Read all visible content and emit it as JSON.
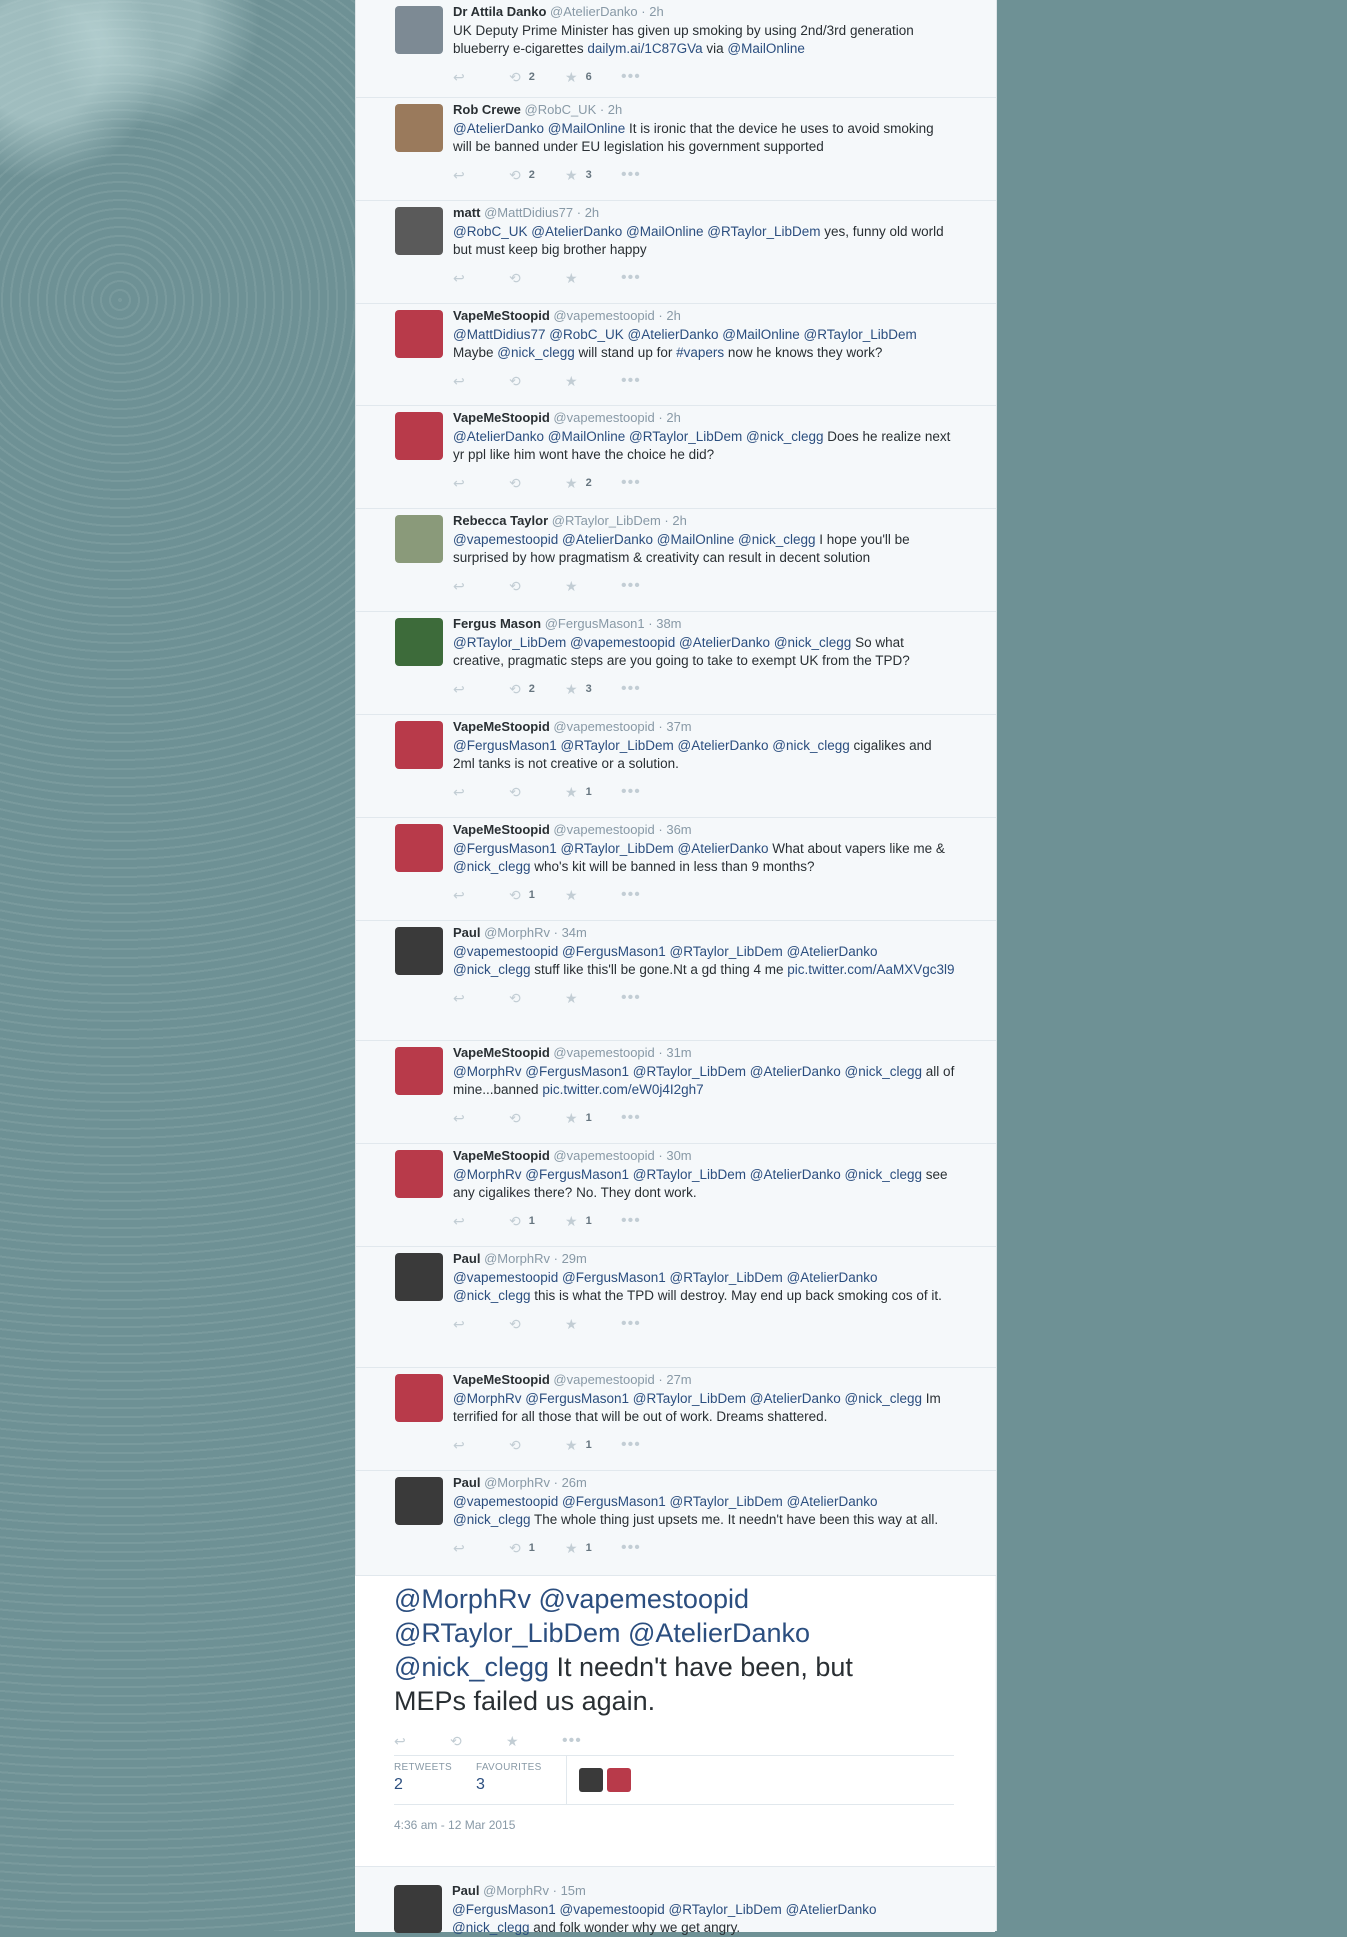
{
  "tweets": [
    {
      "name": "Dr Attila Danko",
      "handle": "@AtelierDanko",
      "time": "· 2h",
      "avatar": "#7d8a94",
      "parts": [
        [
          "UK Deputy Prime Minister has given up smoking by using 2nd/3rd generation blueberry e-cigarettes ",
          false
        ],
        [
          "dailym.ai/1C87GVa",
          true
        ],
        [
          " via ",
          false
        ],
        [
          "@MailOnline",
          true
        ]
      ],
      "retweets": "2",
      "favorites": "6"
    },
    {
      "name": "Rob Crewe",
      "handle": "@RobC_UK",
      "time": "· 2h",
      "avatar": "#9a7a5c",
      "parts": [
        [
          "@AtelierDanko",
          true
        ],
        [
          " ",
          false
        ],
        [
          "@MailOnline",
          true
        ],
        [
          " It is ironic that the device he uses to avoid smoking will be banned under EU legislation his government supported",
          false
        ]
      ],
      "retweets": "2",
      "favorites": "3"
    },
    {
      "name": "matt",
      "handle": "@MattDidius77",
      "time": "· 2h",
      "avatar": "#5a5a5a",
      "parts": [
        [
          "@RobC_UK",
          true
        ],
        [
          " ",
          false
        ],
        [
          "@AtelierDanko",
          true
        ],
        [
          " ",
          false
        ],
        [
          "@MailOnline",
          true
        ],
        [
          " ",
          false
        ],
        [
          "@RTaylor_LibDem",
          true
        ],
        [
          " yes, funny old world but must keep big brother happy",
          false
        ]
      ],
      "retweets": "",
      "favorites": ""
    },
    {
      "name": "VapeMeStoopid",
      "handle": "@vapemestoopid",
      "time": "· 2h",
      "avatar": "#b83a4a",
      "parts": [
        [
          "@MattDidius77",
          true
        ],
        [
          " ",
          false
        ],
        [
          "@RobC_UK",
          true
        ],
        [
          " ",
          false
        ],
        [
          "@AtelierDanko",
          true
        ],
        [
          " ",
          false
        ],
        [
          "@MailOnline",
          true
        ],
        [
          " ",
          false
        ],
        [
          "@RTaylor_LibDem",
          true
        ],
        [
          " Maybe ",
          false
        ],
        [
          "@nick_clegg",
          true
        ],
        [
          " will stand up for ",
          false
        ],
        [
          "#vapers",
          true
        ],
        [
          " now he knows they work?",
          false
        ]
      ],
      "retweets": "",
      "favorites": ""
    },
    {
      "name": "VapeMeStoopid",
      "handle": "@vapemestoopid",
      "time": "· 2h",
      "avatar": "#b83a4a",
      "parts": [
        [
          "@AtelierDanko",
          true
        ],
        [
          " ",
          false
        ],
        [
          "@MailOnline",
          true
        ],
        [
          " ",
          false
        ],
        [
          "@RTaylor_LibDem",
          true
        ],
        [
          " ",
          false
        ],
        [
          "@nick_clegg",
          true
        ],
        [
          " Does he realize next yr ppl like him wont have the choice he did?",
          false
        ]
      ],
      "retweets": "",
      "favorites": "2"
    },
    {
      "name": "Rebecca Taylor",
      "handle": "@RTaylor_LibDem",
      "time": "· 2h",
      "avatar": "#8a9a7a",
      "parts": [
        [
          "@vapemestoopid",
          true
        ],
        [
          " ",
          false
        ],
        [
          "@AtelierDanko",
          true
        ],
        [
          " ",
          false
        ],
        [
          "@MailOnline",
          true
        ],
        [
          " ",
          false
        ],
        [
          "@nick_clegg",
          true
        ],
        [
          " I hope you'll be surprised by how pragmatism & creativity can result in decent solution",
          false
        ]
      ],
      "retweets": "",
      "favorites": ""
    },
    {
      "name": "Fergus Mason",
      "handle": "@FergusMason1",
      "time": "· 38m",
      "avatar": "#3d6b3a",
      "parts": [
        [
          "@RTaylor_LibDem",
          true
        ],
        [
          " ",
          false
        ],
        [
          "@vapemestoopid",
          true
        ],
        [
          " ",
          false
        ],
        [
          "@AtelierDanko",
          true
        ],
        [
          " ",
          false
        ],
        [
          "@nick_clegg",
          true
        ],
        [
          " So what creative, pragmatic steps are you going to take to exempt UK from the TPD?",
          false
        ]
      ],
      "retweets": "2",
      "favorites": "3"
    },
    {
      "name": "VapeMeStoopid",
      "handle": "@vapemestoopid",
      "time": "· 37m",
      "avatar": "#b83a4a",
      "parts": [
        [
          "@FergusMason1",
          true
        ],
        [
          " ",
          false
        ],
        [
          "@RTaylor_LibDem",
          true
        ],
        [
          " ",
          false
        ],
        [
          "@AtelierDanko",
          true
        ],
        [
          " ",
          false
        ],
        [
          "@nick_clegg",
          true
        ],
        [
          " cigalikes and 2ml tanks is not creative or a solution.",
          false
        ]
      ],
      "retweets": "",
      "favorites": "1"
    },
    {
      "name": "VapeMeStoopid",
      "handle": "@vapemestoopid",
      "time": "· 36m",
      "avatar": "#b83a4a",
      "parts": [
        [
          "@FergusMason1",
          true
        ],
        [
          " ",
          false
        ],
        [
          "@RTaylor_LibDem",
          true
        ],
        [
          " ",
          false
        ],
        [
          "@AtelierDanko",
          true
        ],
        [
          " What about vapers like me & ",
          false
        ],
        [
          "@nick_clegg",
          true
        ],
        [
          " who's kit will be banned in less than 9 months?",
          false
        ]
      ],
      "retweets": "1",
      "favorites": ""
    },
    {
      "name": "Paul",
      "handle": "@MorphRv",
      "time": "· 34m",
      "avatar": "#3a3a3a",
      "parts": [
        [
          "@vapemestoopid",
          true
        ],
        [
          " ",
          false
        ],
        [
          "@FergusMason1",
          true
        ],
        [
          " ",
          false
        ],
        [
          "@RTaylor_LibDem",
          true
        ],
        [
          " ",
          false
        ],
        [
          "@AtelierDanko",
          true
        ],
        [
          " ",
          false
        ],
        [
          "@nick_clegg",
          true
        ],
        [
          " stuff like this'll be gone.Nt a gd thing 4 me ",
          false
        ],
        [
          "pic.twitter.com/AaMXVgc3l9",
          true
        ]
      ],
      "retweets": "",
      "favorites": ""
    },
    {
      "name": "VapeMeStoopid",
      "handle": "@vapemestoopid",
      "time": "· 31m",
      "avatar": "#b83a4a",
      "parts": [
        [
          "@MorphRv",
          true
        ],
        [
          " ",
          false
        ],
        [
          "@FergusMason1",
          true
        ],
        [
          " ",
          false
        ],
        [
          "@RTaylor_LibDem",
          true
        ],
        [
          " ",
          false
        ],
        [
          "@AtelierDanko",
          true
        ],
        [
          " ",
          false
        ],
        [
          "@nick_clegg",
          true
        ],
        [
          " all of mine...banned ",
          false
        ],
        [
          "pic.twitter.com/eW0j4I2gh7",
          true
        ]
      ],
      "retweets": "",
      "favorites": "1"
    },
    {
      "name": "VapeMeStoopid",
      "handle": "@vapemestoopid",
      "time": "· 30m",
      "avatar": "#b83a4a",
      "parts": [
        [
          "@MorphRv",
          true
        ],
        [
          " ",
          false
        ],
        [
          "@FergusMason1",
          true
        ],
        [
          " ",
          false
        ],
        [
          "@RTaylor_LibDem",
          true
        ],
        [
          " ",
          false
        ],
        [
          "@AtelierDanko",
          true
        ],
        [
          " ",
          false
        ],
        [
          "@nick_clegg",
          true
        ],
        [
          " see any cigalikes there? No. They dont work.",
          false
        ]
      ],
      "retweets": "1",
      "favorites": "1"
    },
    {
      "name": "Paul",
      "handle": "@MorphRv",
      "time": "· 29m",
      "avatar": "#3a3a3a",
      "parts": [
        [
          "@vapemestoopid",
          true
        ],
        [
          " ",
          false
        ],
        [
          "@FergusMason1",
          true
        ],
        [
          " ",
          false
        ],
        [
          "@RTaylor_LibDem",
          true
        ],
        [
          " ",
          false
        ],
        [
          "@AtelierDanko",
          true
        ],
        [
          " ",
          false
        ],
        [
          "@nick_clegg",
          true
        ],
        [
          " this is what the TPD will destroy. May end up back smoking cos of it.",
          false
        ]
      ],
      "retweets": "",
      "favorites": ""
    },
    {
      "name": "VapeMeStoopid",
      "handle": "@vapemestoopid",
      "time": "· 27m",
      "avatar": "#b83a4a",
      "parts": [
        [
          "@MorphRv",
          true
        ],
        [
          " ",
          false
        ],
        [
          "@FergusMason1",
          true
        ],
        [
          " ",
          false
        ],
        [
          "@RTaylor_LibDem",
          true
        ],
        [
          " ",
          false
        ],
        [
          "@AtelierDanko",
          true
        ],
        [
          " ",
          false
        ],
        [
          "@nick_clegg",
          true
        ],
        [
          " Im terrified for all those that will be out of work. Dreams shattered.",
          false
        ]
      ],
      "retweets": "",
      "favorites": "1"
    },
    {
      "name": "Paul",
      "handle": "@MorphRv",
      "time": "· 26m",
      "avatar": "#3a3a3a",
      "parts": [
        [
          "@vapemestoopid",
          true
        ],
        [
          " ",
          false
        ],
        [
          "@FergusMason1",
          true
        ],
        [
          " ",
          false
        ],
        [
          "@RTaylor_LibDem",
          true
        ],
        [
          " ",
          false
        ],
        [
          "@AtelierDanko",
          true
        ],
        [
          " ",
          false
        ],
        [
          "@nick_clegg",
          true
        ],
        [
          " The whole thing just upsets me. It needn't have been this way at all.",
          false
        ]
      ],
      "retweets": "1",
      "favorites": "1"
    }
  ],
  "main": {
    "parts": [
      [
        "@MorphRv",
        true
      ],
      [
        " ",
        false
      ],
      [
        "@vapemestoopid",
        true
      ],
      [
        " ",
        false
      ],
      [
        "@RTaylor_LibDem",
        true
      ],
      [
        " ",
        false
      ],
      [
        "@AtelierDanko",
        true
      ],
      [
        " ",
        false
      ],
      [
        "@nick_clegg",
        true
      ],
      [
        " It needn't have been, but MEPs failed us again.",
        false
      ]
    ],
    "retweets_label": "RETWEETS",
    "retweets": "2",
    "favourites_label": "FAVOURITES",
    "favourites": "3",
    "timestamp": "4:36 am - 12 Mar 2015"
  },
  "last": {
    "name": "Paul",
    "handle": "@MorphRv",
    "time": "· 15m",
    "avatar": "#3a3a3a",
    "parts": [
      [
        "@FergusMason1",
        true
      ],
      [
        " ",
        false
      ],
      [
        "@vapemestoopid",
        true
      ],
      [
        " ",
        false
      ],
      [
        "@RTaylor_LibDem",
        true
      ],
      [
        " ",
        false
      ],
      [
        "@AtelierDanko",
        true
      ],
      [
        " ",
        false
      ],
      [
        "@nick_clegg",
        true
      ],
      [
        " and folk wonder why we get angry.",
        false
      ]
    ]
  },
  "icons": {
    "reply": "reply-icon",
    "retweet": "retweet-icon",
    "favorite": "star-icon",
    "more": "more-icon"
  }
}
